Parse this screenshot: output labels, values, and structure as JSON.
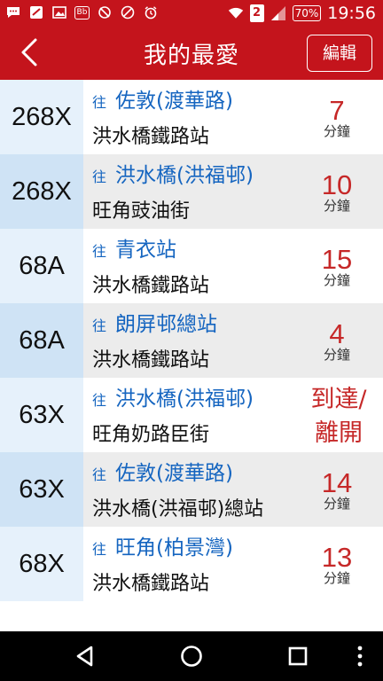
{
  "status_bar": {
    "time": "19:56",
    "battery": "70%",
    "sim_slot": "2",
    "icons": [
      "chat-icon",
      "app-icon",
      "image-icon",
      "bb-icon",
      "sync-off-icon",
      "dnd-icon",
      "alarm-icon",
      "wifi-icon",
      "signal-icon",
      "battery-icon"
    ]
  },
  "app_bar": {
    "title": "我的最愛",
    "edit_label": "編輯"
  },
  "colors": {
    "brand_red": "#c4141c",
    "route_bg_light": "#e6f1fb",
    "route_bg_dark": "#cfe3f5",
    "row_alt_bg": "#ececec",
    "destination_blue": "#1565c0",
    "eta_red": "#c62828"
  },
  "favorites": [
    {
      "route": "268X",
      "to_label": "往",
      "destination": "佐敦(渡華路)",
      "stop": "洪水橋鐵路站",
      "eta": "7",
      "eta_unit": "分鐘"
    },
    {
      "route": "268X",
      "to_label": "往",
      "destination": "洪水橋(洪福邨)",
      "stop": "旺角豉油街",
      "eta": "10",
      "eta_unit": "分鐘"
    },
    {
      "route": "68A",
      "to_label": "往",
      "destination": "青衣站",
      "stop": "洪水橋鐵路站",
      "eta": "15",
      "eta_unit": "分鐘"
    },
    {
      "route": "68A",
      "to_label": "往",
      "destination": "朗屏邨總站",
      "stop": "洪水橋鐵路站",
      "eta": "4",
      "eta_unit": "分鐘"
    },
    {
      "route": "63X",
      "to_label": "往",
      "destination": "洪水橋(洪福邨)",
      "stop": "旺角奶路臣街",
      "eta_text_1": "到達/",
      "eta_text_2": "離開"
    },
    {
      "route": "63X",
      "to_label": "往",
      "destination": "佐敦(渡華路)",
      "stop": "洪水橋(洪福邨)總站",
      "eta": "14",
      "eta_unit": "分鐘"
    },
    {
      "route": "68X",
      "to_label": "往",
      "destination": "旺角(柏景灣)",
      "stop": "洪水橋鐵路站",
      "eta": "13",
      "eta_unit": "分鐘"
    }
  ],
  "nav_bar": {
    "icons": [
      "back-triangle-icon",
      "home-circle-icon",
      "recents-square-icon",
      "overflow-dots-icon"
    ]
  }
}
